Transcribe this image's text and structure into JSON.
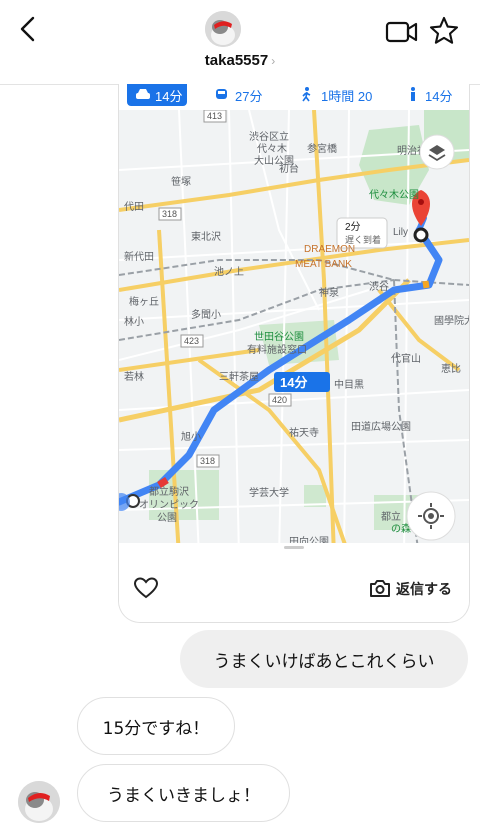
{
  "header": {
    "username": "taka5557",
    "chevron": "›",
    "back_icon": "chevron-left-icon",
    "video_icon": "video-camera-icon",
    "star_icon": "star-icon"
  },
  "map_card": {
    "tabs": [
      {
        "mode": "car",
        "label": "14分"
      },
      {
        "mode": "train",
        "label": "27分"
      },
      {
        "mode": "walk",
        "label": "1時間 20"
      },
      {
        "mode": "transit",
        "label": "14分"
      }
    ],
    "labels": {
      "shibuya_ward": "渋谷区立",
      "yoyogi_park_small": "代々木",
      "oyama_park": "大山公園",
      "hatsudai": "初台",
      "sangubashi": "参宮橋",
      "meiji_jingu": "明治神",
      "sasazuka": "笹塚",
      "yoyogi_park": "代々木公園",
      "higashikitazawa": "東北沢",
      "shinyoyogi": "代田",
      "shinjuku_lane": "新代田",
      "ikenoue": "池ノ上",
      "dreamon": "DRAEMON",
      "meatbank": "MEAT BANK",
      "umegaoka": "梅ヶ丘",
      "shimokitazawa": "多聞小",
      "wakabayashi": "若林",
      "setagaya_park": "世田谷公園",
      "setagaya_park2": "有料施設窓口",
      "sangenjaya": "三軒茶屋",
      "shinsen": "神泉",
      "shibuya": "渋谷",
      "daikanyama": "代官山",
      "kokugakuin": "國學院大",
      "nakameguro": "中目黒",
      "ebisu": "恵比",
      "yutenji": "祐天寺",
      "komazawa": "都立駒沢",
      "komazawa2": "オリンピック",
      "komazawa3": "公園",
      "gakugei": "学芸大学",
      "denenchofu": "田向公園",
      "dendo_hiroba": "田道広場公園",
      "toritsu": "都立",
      "mori": "の森",
      "route_318": "318",
      "route_423": "423",
      "route_420": "420",
      "route_413": "413",
      "lily": "Lily",
      "lin": "林小",
      "kaki": "旭小",
      "ikeo": "池尻",
      "tooltip_time": "2分",
      "tooltip_note": "遅く到着",
      "route_badge": "14分"
    }
  },
  "reply_row": {
    "heart_icon": "heart-icon",
    "camera_icon": "camera-icon",
    "reply_label": "返信する"
  },
  "messages": [
    {
      "side": "out",
      "text": "うまくいけばあとこれくらい"
    },
    {
      "side": "in",
      "text": "15分ですね！"
    },
    {
      "side": "in",
      "text": "うまくいきましょ！"
    }
  ]
}
